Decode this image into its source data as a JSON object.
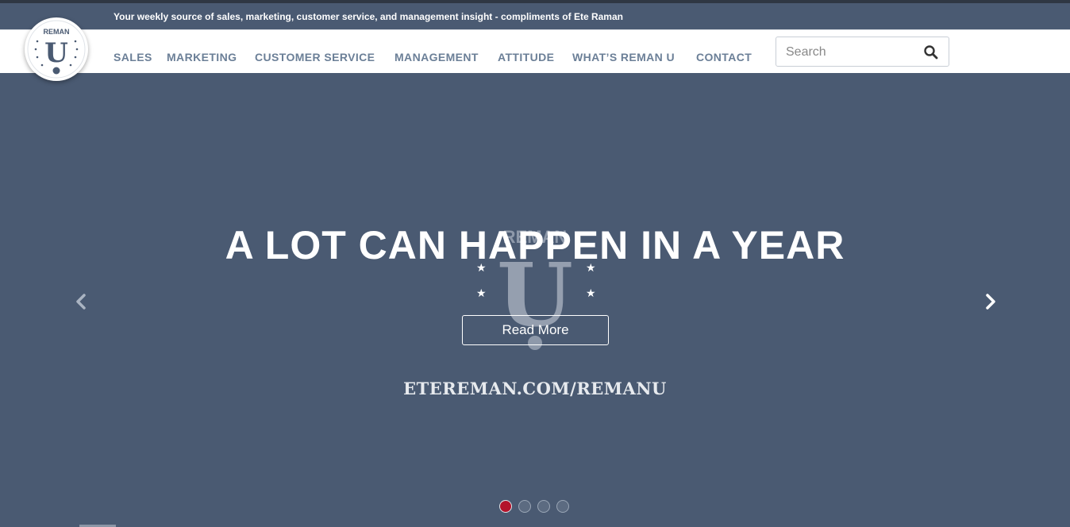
{
  "tagline": "Your weekly source of sales, marketing, customer service, and management insight - compliments of Ete Raman",
  "logo": {
    "top_text": "REMAN",
    "letter": "U",
    "icon": "reman-u-logo"
  },
  "nav": {
    "items": [
      {
        "label": "SALES"
      },
      {
        "label": "MARKETING"
      },
      {
        "label": "CUSTOMER SERVICE"
      },
      {
        "label": "MANAGEMENT"
      },
      {
        "label": "ATTITUDE"
      },
      {
        "label": "WHAT’S REMAN U"
      },
      {
        "label": "CONTACT"
      }
    ]
  },
  "search": {
    "placeholder": "Search",
    "icon": "search-icon"
  },
  "hero": {
    "headline": "A LOT CAN HAPPEN IN A YEAR",
    "cta_label": "Read More",
    "url_text": "ETEREMAN.COM/REMANU",
    "watermark_top_text": "REMAN",
    "watermark_letter": "U",
    "prev_icon": "chevron-left-icon",
    "next_icon": "chevron-right-icon"
  },
  "carousel": {
    "slide_count": 4,
    "active_index": 0
  },
  "colors": {
    "brand_blue": "#4a5a72",
    "nav_text": "#6b7f97",
    "active_dot": "#b3132b"
  }
}
